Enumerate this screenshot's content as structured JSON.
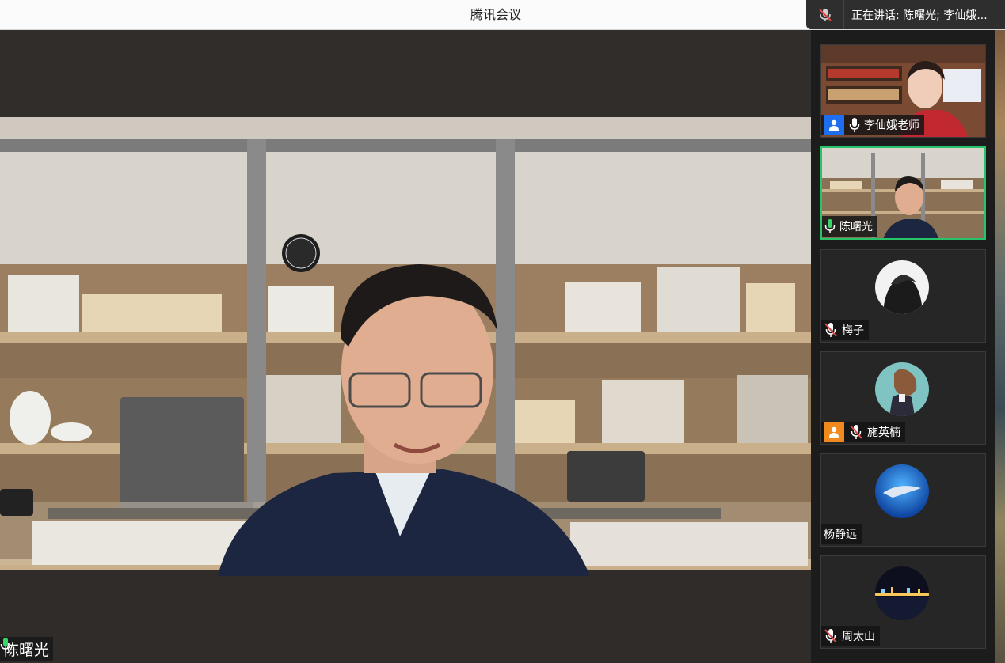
{
  "app": {
    "title": "腾讯会议"
  },
  "speaking": {
    "text": "正在讲话: 陈曙光; 李仙娥..."
  },
  "main": {
    "speaker_name": "陈曙光"
  },
  "participants": [
    {
      "name": "李仙娥老师",
      "mic": "on",
      "badge": "host-blue",
      "video": true
    },
    {
      "name": "陈曙光",
      "mic": "on",
      "badge": "",
      "video": true,
      "active": true
    },
    {
      "name": "梅子",
      "mic": "muted",
      "badge": "",
      "video": false
    },
    {
      "name": "施英楠",
      "mic": "muted",
      "badge": "cohost-orange",
      "video": false
    },
    {
      "name": "杨静远",
      "mic": "none",
      "badge": "",
      "video": false
    },
    {
      "name": "周太山",
      "mic": "muted",
      "badge": "",
      "video": false
    }
  ],
  "colors": {
    "active_border": "#27c46a",
    "host_badge": "#1e6ef0",
    "cohost_badge": "#f08a1e",
    "mic_green": "#3ad66b",
    "muted_red": "#e04545"
  }
}
